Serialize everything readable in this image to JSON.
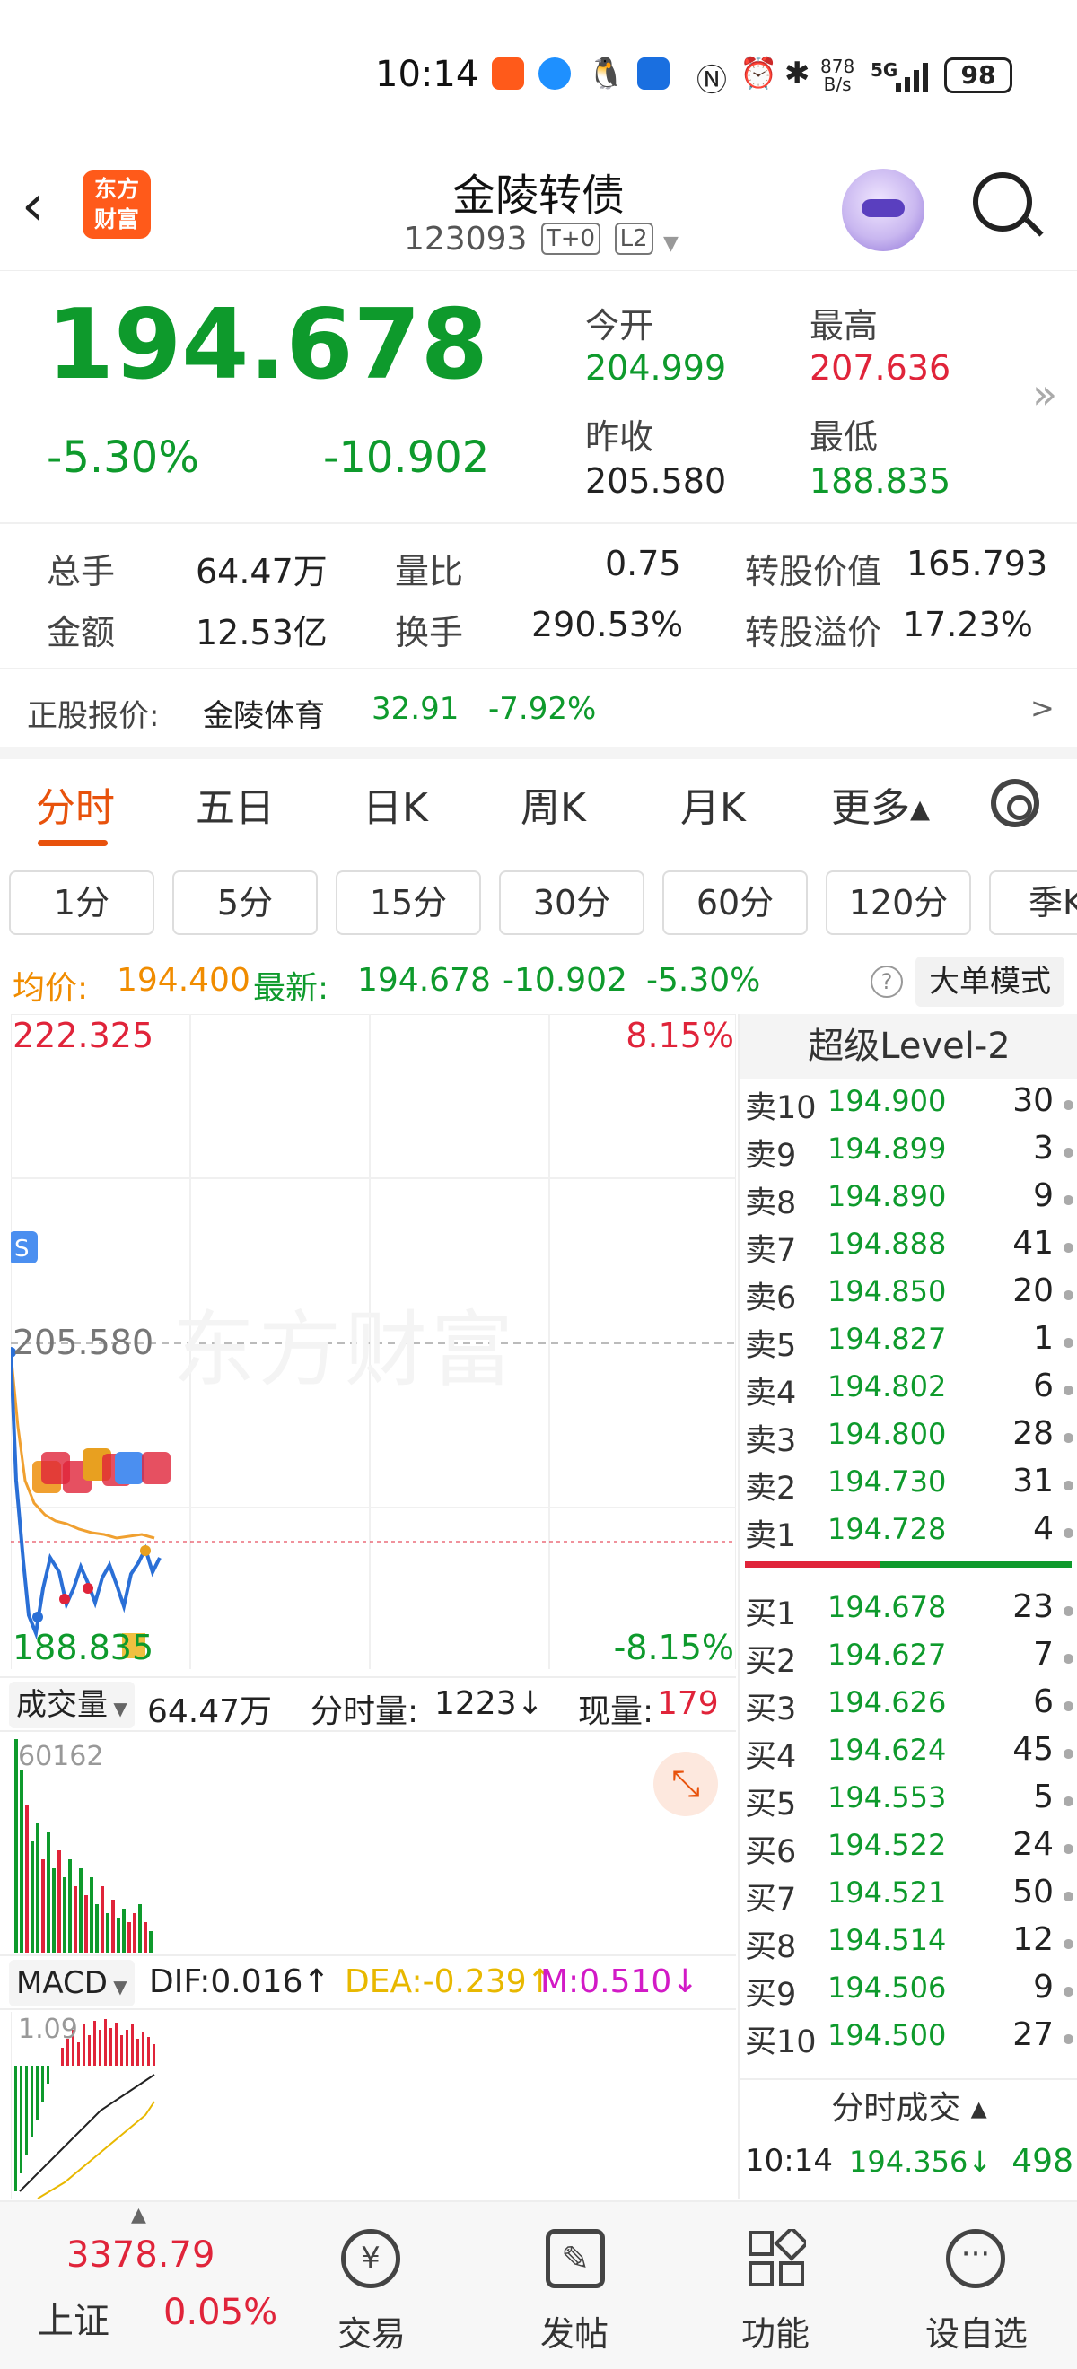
{
  "status_bar": {
    "time": "10:14",
    "speed_top": "878",
    "speed_bottom": "B/s",
    "network": "5G",
    "battery": "98"
  },
  "header": {
    "title": "金陵转债",
    "code": "123093",
    "tag1": "T+0",
    "tag2": "L2",
    "logo_line1": "东方",
    "logo_line2": "财富"
  },
  "quote": {
    "price": "194.678",
    "change_pct": "-5.30%",
    "change": "-10.902",
    "open_label": "今开",
    "open": "204.999",
    "high_label": "最高",
    "high": "207.636",
    "prev_close_label": "昨收",
    "prev_close": "205.580",
    "low_label": "最低",
    "low": "188.835"
  },
  "stats": {
    "volume_label": "总手",
    "volume": "64.47万",
    "amount_label": "金额",
    "amount": "12.53亿",
    "vol_ratio_label": "量比",
    "vol_ratio": "0.75",
    "turnover_label": "换手",
    "turnover": "290.53%",
    "conv_value_label": "转股价值",
    "conv_value": "165.793",
    "conv_premium_label": "转股溢价",
    "conv_premium": "17.23%"
  },
  "stock": {
    "label": "正股报价:",
    "name": "金陵体育",
    "price": "32.91",
    "change": "-7.92%",
    "arrow": ">"
  },
  "tabs": [
    "分时",
    "五日",
    "日K",
    "周K",
    "月K",
    "更多▴"
  ],
  "periods": [
    "1分",
    "5分",
    "15分",
    "30分",
    "60分",
    "120分",
    "季K"
  ],
  "info": {
    "avg_label": "均价:",
    "avg": "194.400",
    "latest_label": "最新:",
    "latest": "194.678",
    "chg": "-10.902",
    "pct": "-5.30%",
    "mode": "大单模式"
  },
  "chart": {
    "top_price": "222.325",
    "top_pct": "8.15%",
    "mid_price": "205.580",
    "bottom_price": "188.835",
    "bottom_pct": "-8.15%",
    "watermark": "东方财富",
    "volume_label": "成交量",
    "volume_total": "64.47万",
    "period_vol_label": "分时量:",
    "period_vol": "1223↓",
    "current_label": "现量:",
    "current": "179",
    "vol_max": "60162",
    "macd_label": "MACD",
    "dif": "DIF:0.016↑",
    "dea": "DEA:-0.239↑",
    "m": "M:0.510↓",
    "macd_max": "1.09"
  },
  "orderbook": {
    "title": "超级Level-2",
    "asks": [
      {
        "label": "卖10",
        "price": "194.900",
        "qty": "30"
      },
      {
        "label": "卖9",
        "price": "194.899",
        "qty": "3"
      },
      {
        "label": "卖8",
        "price": "194.890",
        "qty": "9"
      },
      {
        "label": "卖7",
        "price": "194.888",
        "qty": "41"
      },
      {
        "label": "卖6",
        "price": "194.850",
        "qty": "20"
      },
      {
        "label": "卖5",
        "price": "194.827",
        "qty": "1"
      },
      {
        "label": "卖4",
        "price": "194.802",
        "qty": "6"
      },
      {
        "label": "卖3",
        "price": "194.800",
        "qty": "28"
      },
      {
        "label": "卖2",
        "price": "194.730",
        "qty": "31"
      },
      {
        "label": "卖1",
        "price": "194.728",
        "qty": "4"
      }
    ],
    "bids": [
      {
        "label": "买1",
        "price": "194.678",
        "qty": "23"
      },
      {
        "label": "买2",
        "price": "194.627",
        "qty": "7"
      },
      {
        "label": "买3",
        "price": "194.626",
        "qty": "6"
      },
      {
        "label": "买4",
        "price": "194.624",
        "qty": "45"
      },
      {
        "label": "买5",
        "price": "194.553",
        "qty": "5"
      },
      {
        "label": "买6",
        "price": "194.522",
        "qty": "24"
      },
      {
        "label": "买7",
        "price": "194.521",
        "qty": "50"
      },
      {
        "label": "买8",
        "price": "194.514",
        "qty": "12"
      },
      {
        "label": "买9",
        "price": "194.506",
        "qty": "9"
      },
      {
        "label": "买10",
        "price": "194.500",
        "qty": "27"
      }
    ],
    "trades_title": "分时成交 ▴",
    "trade": {
      "time": "10:14",
      "price": "194.356↓",
      "qty": "498"
    }
  },
  "bottom_nav": {
    "index_value": "3378.79",
    "index_name": "上证",
    "index_pct": "0.05%",
    "items": [
      "交易",
      "发帖",
      "功能",
      "设自选"
    ]
  }
}
